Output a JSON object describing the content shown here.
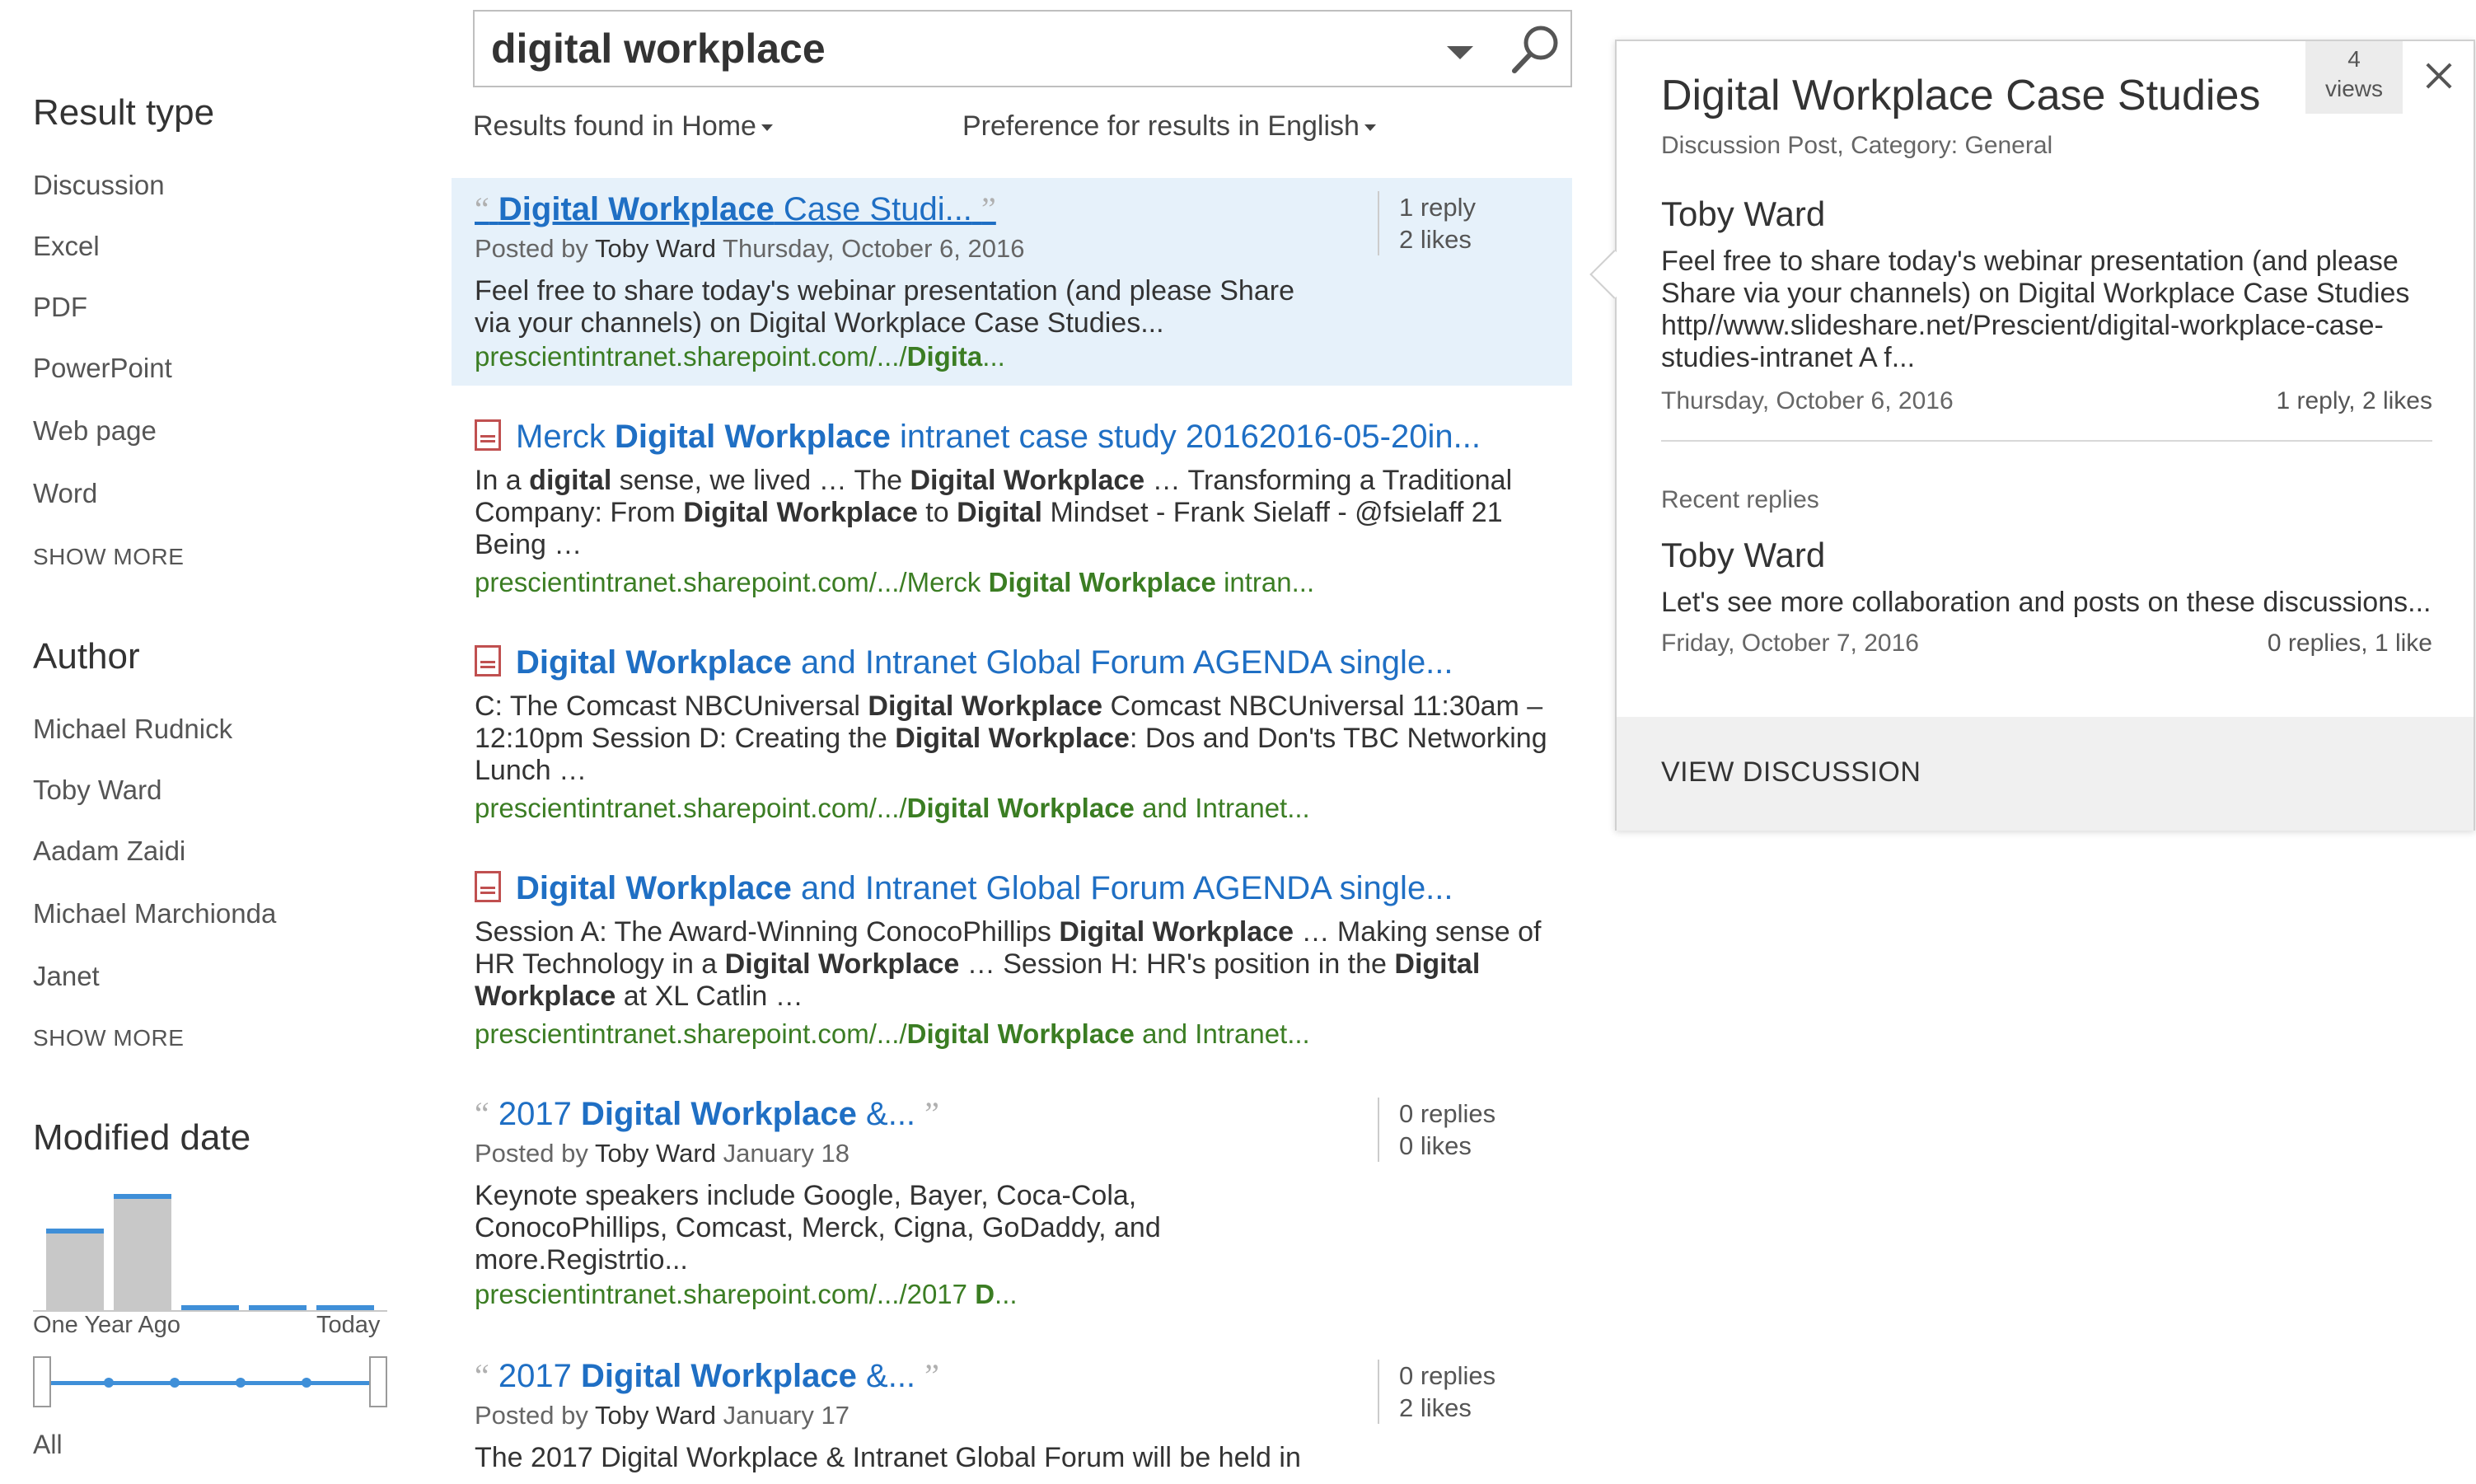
{
  "search": {
    "query": "digital workplace"
  },
  "scope": {
    "results_found_label": "Results found in",
    "results_found_value": "Home",
    "preference_label": "Preference for results in",
    "preference_value": "English"
  },
  "refiners": {
    "result_type": {
      "heading": "Result type",
      "items": [
        "Discussion",
        "Excel",
        "PDF",
        "PowerPoint",
        "Web page",
        "Word"
      ],
      "show_more": "SHOW MORE"
    },
    "author": {
      "heading": "Author",
      "items": [
        "Michael Rudnick",
        "Toby Ward",
        "Aadam Zaidi",
        "Michael Marchionda",
        "Janet"
      ],
      "show_more": "SHOW MORE"
    },
    "modified_date": {
      "heading": "Modified date",
      "histogram": [
        0.62,
        0.88,
        0.04,
        0.04,
        0.04
      ],
      "start_label": "One Year Ago",
      "end_label": "Today",
      "range_label": "All"
    }
  },
  "results": [
    {
      "title_bold": "Digital Workplace",
      "title_rest": " Case Studi...",
      "meta_posted": "Posted by",
      "meta_author": "Toby Ward",
      "meta_date": "Thursday, October 6, 2016",
      "summary": "Feel free to share today's webinar presentation (and please Share via your channels) on Digital Workplace Case Studies...",
      "url_plain": "prescientintranet.sharepoint.com/.../",
      "url_bold": "Digita",
      "url_tail": "...",
      "stat1": "1 reply",
      "stat2": "2 likes"
    },
    {
      "t1": "Merck ",
      "t2": "Digital Workplace",
      "t3": " intranet case study 20162016-05-20in...",
      "s1": "In a ",
      "s2": "digital",
      "s3": " sense, we lived … The ",
      "s4": "Digital Workplace",
      "s5": " … Transforming a Traditional Company: From ",
      "s6": "Digital Workplace",
      "s7": " to ",
      "s8": "Digital",
      "s9": " Mindset - Frank Sielaff - @fsielaff 21 Being …",
      "u1": "prescientintranet.sharepoint.com/.../Merck ",
      "u2": "Digital Workplace",
      "u3": " intran..."
    },
    {
      "t1": "Digital Workplace",
      "t2": " and Intranet Global Forum AGENDA single...",
      "s1": "C: The Comcast NBCUniversal ",
      "s2": "Digital Workplace",
      "s3": " Comcast NBCUniversal 11:30am – 12:10pm Session D: Creating the ",
      "s4": "Digital Workplace",
      "s5": ": Dos and Don'ts TBC Networking Lunch …",
      "u1": "prescientintranet.sharepoint.com/.../",
      "u2": "Digital Workplace",
      "u3": " and Intranet..."
    },
    {
      "t1": "Digital Workplace",
      "t2": " and Intranet Global Forum AGENDA single...",
      "s1": "Session A: The Award-Winning ConocoPhillips ",
      "s2": "Digital Workplace",
      "s3": " … Making sense of HR Technology in a ",
      "s4": "Digital Workplace",
      "s5": " … Session H: HR's position in the ",
      "s6": "Digital Workplace",
      "s7": " at XL Catlin …",
      "u1": "prescientintranet.sharepoint.com/.../",
      "u2": "Digital Workplace",
      "u3": " and Intranet..."
    },
    {
      "t1": "2017 ",
      "t2": "Digital Workplace",
      "t3": " &...",
      "meta_posted": "Posted by",
      "meta_author": "Toby Ward",
      "meta_date": "January 18",
      "summary": "Keynote speakers include Google, Bayer, Coca-Cola, ConocoPhillips, Comcast, Merck, Cigna, GoDaddy, and more.Registrtio...",
      "u1": "prescientintranet.sharepoint.com/.../2017 ",
      "u2": "D",
      "u3": "...",
      "stat1": "0 replies",
      "stat2": "0 likes"
    },
    {
      "t1": "2017 ",
      "t2": "Digital Workplace",
      "t3": " &...",
      "meta_posted": "Posted by",
      "meta_author": "Toby Ward",
      "meta_date": "January 17",
      "summary": "The 2017 Digital Workplace & Intranet Global Forum will be held in",
      "stat1": "0 replies",
      "stat2": "2 likes"
    }
  ],
  "hover_panel": {
    "title": "Digital Workplace Case Studies",
    "subtitle": "Discussion Post, Category: General",
    "views_count": "4",
    "views_label": "views",
    "author": "Toby Ward",
    "body": "Feel free to share today's webinar presentation (and please Share via your channels) on Digital Workplace Case Studies http//www.slideshare.net/Prescient/digital-workplace-case-studies-intranet A f...",
    "date": "Thursday, October 6, 2016",
    "stats": "1 reply, 2 likes",
    "recent_label": "Recent replies",
    "reply_author": "Toby Ward",
    "reply_body": "Let's see more collaboration and posts on these discussions...",
    "reply_date": "Friday, October 7, 2016",
    "reply_stats": "0 replies, 1 like",
    "view_button": "VIEW DISCUSSION"
  },
  "colors": {
    "link_blue": "#1f6fc4",
    "url_green": "#3b7d23",
    "selected_bg": "#e6f1fa",
    "slider_blue": "#3f8fd8"
  }
}
